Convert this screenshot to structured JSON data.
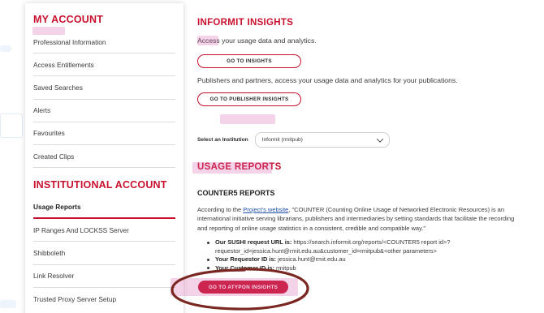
{
  "sidebar": {
    "my_account": {
      "title": "MY ACCOUNT",
      "items": [
        {
          "label": "Professional Information"
        },
        {
          "label": "Access Entitlements"
        },
        {
          "label": "Saved Searches"
        },
        {
          "label": "Alerts"
        },
        {
          "label": "Favourites"
        },
        {
          "label": "Created Clips"
        }
      ]
    },
    "institutional": {
      "title": "INSTITUTIONAL ACCOUNT",
      "items": [
        {
          "label": "Usage Reports",
          "active": true
        },
        {
          "label": "IP Ranges And LOCKSS Server"
        },
        {
          "label": "Shibboleth"
        },
        {
          "label": "Link Resolver"
        },
        {
          "label": "Trusted Proxy Server Setup"
        }
      ]
    }
  },
  "main": {
    "insights_title": "INFORMIT INSIGHTS",
    "insights_text": "Access your usage data and analytics.",
    "go_insights": "GO TO INSIGHTS",
    "publishers_text": "Publishers and partners, access your usage data and analytics for your publications.",
    "go_publisher": "GO TO PUBLISHER INSIGHTS",
    "select_label": "Select an Institution",
    "institution_value": "Informit (rmitpub)",
    "usage_title": "USAGE REPORTS",
    "counter_title": "COUNTER5 REPORTS",
    "para_prefix": "According to the ",
    "para_link": "Project's website",
    "para_rest": ", \"COUNTER (Counting Online Usage of Networked Electronic Resources) is an international initiative serving librarians, publishers and intermediaries by setting standards that facilitate the recording and reporting of online usage statistics in a consistent, credible and compatible way.\"",
    "sushi_label": "Our SUSHI request URL is:",
    "sushi_value": " https://search.informit.org/reports/<COUNTER5 report id>?requestor_id=jessica.hunt@rmit.edu.au&customer_id=rmitpub&<other parameters>",
    "requestor_label": "Your Requestor ID is:",
    "requestor_value": " jessica.hunt@rmit.edu.au",
    "customer_label": "Your Customer ID is:",
    "customer_value": " rmitpub",
    "atypon_button": "GO TO ATYPON INSIGHTS"
  },
  "colors": {
    "accent": "#c8102e",
    "link": "#1f4fa8",
    "highlight": "#d65faa"
  }
}
